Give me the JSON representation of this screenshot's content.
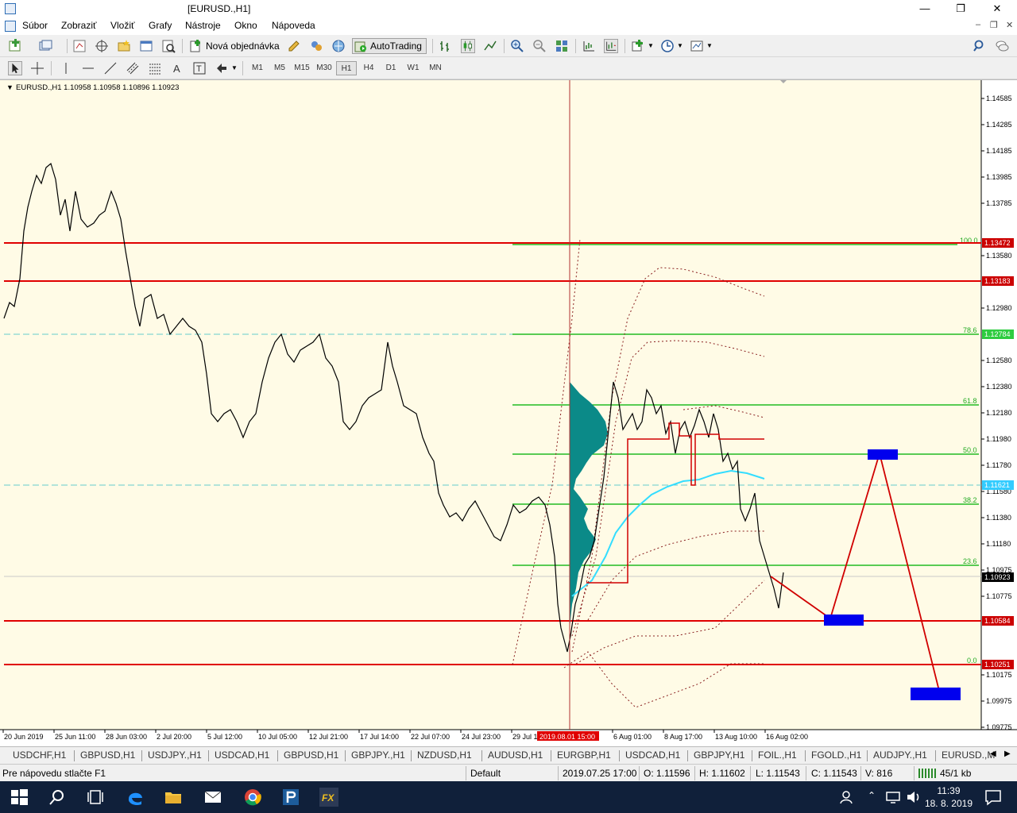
{
  "window": {
    "title": "[EURUSD.,H1]"
  },
  "menu": {
    "items": [
      "Súbor",
      "Zobraziť",
      "Vložiť",
      "Grafy",
      "Nástroje",
      "Okno",
      "Nápoveda"
    ]
  },
  "toolbar": {
    "new_order_label": "Nová objednávka",
    "autotrading_label": "AutoTrading"
  },
  "timeframes": [
    "M1",
    "M5",
    "M15",
    "M30",
    "H1",
    "H4",
    "D1",
    "W1",
    "MN"
  ],
  "timeframe_active": "H1",
  "chart": {
    "header": "EURUSD.,H1  1.10958 1.10958 1.10896 1.10923",
    "price_ticks": [
      "1.14585",
      "1.14285",
      "1.14185",
      "1.13985",
      "1.13785",
      "1.13580",
      "1.12980",
      "1.12580",
      "1.12380",
      "1.12180",
      "1.11980",
      "1.11780",
      "1.11580",
      "1.11380",
      "1.11180",
      "1.10975",
      "1.10775",
      "1.10175",
      "1.09975",
      "1.09775"
    ],
    "time_ticks": [
      "20 Jun 2019",
      "25 Jun 11:00",
      "28 Jun 03:00",
      "2 Jul 20:00",
      "5 Jul 12:00",
      "10 Jul 05:00",
      "12 Jul 21:00",
      "17 Jul 14:00",
      "22 Jul 07:00",
      "24 Jul 23:00",
      "29 Jul 1",
      "6 Aug 01:00",
      "8 Aug 17:00",
      "13 Aug 10:00",
      "16 Aug 02:00"
    ],
    "cursor_time_label": "2019.08.01 15:00",
    "level_labels": [
      {
        "text": "1.13472",
        "color": "#cc0000"
      },
      {
        "text": "1.13183",
        "color": "#cc0000"
      },
      {
        "text": "1.12784",
        "color": "#2ecc40"
      },
      {
        "text": "1.11621",
        "color": "#33ccff"
      },
      {
        "text": "1.10923",
        "color": "#000000"
      },
      {
        "text": "1.10584",
        "color": "#cc0000"
      },
      {
        "text": "1.10251",
        "color": "#cc0000"
      }
    ],
    "fib_labels": [
      "100.0",
      "78.6",
      "61.8",
      "50.0",
      "38.2",
      "23.6",
      "0.0"
    ],
    "colors": {
      "background": "#fffbe6",
      "candles": "#000000",
      "sr_line": "#e00000",
      "fib": "#22bb22",
      "dashed": "#66cccc",
      "profile": "#0b8a88",
      "ma": "#33ddff",
      "target": "#0000ee"
    }
  },
  "tabs": [
    "USDCHF,H1",
    "GBPUSD,H1",
    "USDJPY.,H1",
    "USDCAD,H1",
    "GBPUSD,H1",
    "GBPJPY.,H1",
    "NZDUSD,H1",
    "AUDUSD,H1",
    "EURGBP,H1",
    "USDCAD,H1",
    "GBPJPY,H1",
    "FOIL.,H1",
    "FGOLD.,H1",
    "AUDJPY.,H1",
    "EURUSD.,M"
  ],
  "status": {
    "help": "Pre nápovedu stlačte F1",
    "profile": "Default",
    "datetime": "2019.07.25 17:00",
    "open": "O: 1.11596",
    "high": "H: 1.11602",
    "low": "L: 1.11543",
    "close": "C: 1.11543",
    "volume": "V: 816",
    "traffic": "45/1 kb"
  },
  "taskbar": {
    "time": "11:39",
    "date": "18. 8. 2019"
  }
}
